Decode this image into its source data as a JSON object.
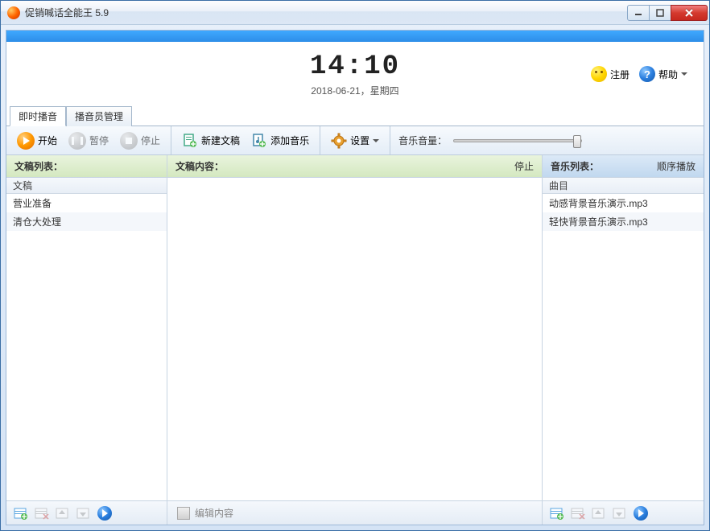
{
  "window": {
    "title": "促销喊话全能王 5.9"
  },
  "header": {
    "time": "14:10",
    "date": "2018-06-21，星期四",
    "register": "注册",
    "help": "帮助"
  },
  "tabs": [
    {
      "label": "即时播音",
      "active": true
    },
    {
      "label": "播音员管理",
      "active": false
    }
  ],
  "toolbar": {
    "start": "开始",
    "pause": "暂停",
    "stop": "停止",
    "new_doc": "新建文稿",
    "add_music": "添加音乐",
    "settings": "设置",
    "volume_label": "音乐音量："
  },
  "columns": {
    "left": {
      "title": "文稿列表：",
      "sub": "文稿",
      "items": [
        "营业准备",
        "清仓大处理"
      ]
    },
    "mid": {
      "title": "文稿内容：",
      "status": "停止",
      "edit_label": "编辑内容"
    },
    "right": {
      "title": "音乐列表：",
      "mode": "顺序播放",
      "sub": "曲目",
      "items": [
        "动感背景音乐演示.mp3",
        "轻快背景音乐演示.mp3"
      ]
    }
  }
}
